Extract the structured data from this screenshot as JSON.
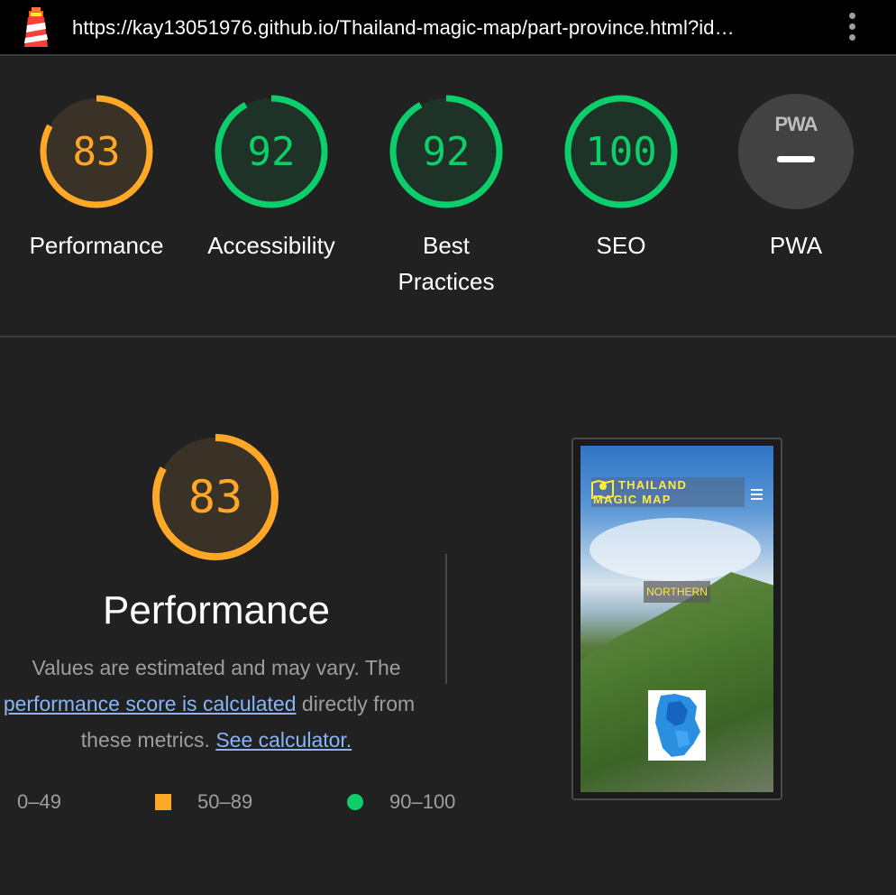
{
  "browser": {
    "url": "https://kay13051976.github.io/Thailand-magic-map/part-province.html?id…"
  },
  "categories": [
    {
      "label": "Performance",
      "score": "83",
      "value": 0.83,
      "status": "average"
    },
    {
      "label": "Accessibility",
      "score": "92",
      "value": 0.92,
      "status": "pass"
    },
    {
      "label": "Best Practices",
      "score": "92",
      "value": 0.92,
      "status": "pass"
    },
    {
      "label": "SEO",
      "score": "100",
      "value": 1.0,
      "status": "pass"
    },
    {
      "label": "PWA",
      "score": "",
      "status": "not-applicable"
    }
  ],
  "pwa_badge": "PWA",
  "performance": {
    "score": "83",
    "value": 0.83,
    "title": "Performance",
    "desc_line1": "Values are estimated and may vary. The",
    "desc_link": "performance score is calculated",
    "desc_line2_rest": " directly from",
    "desc_line3": "these metrics. ",
    "calculator_link": "See calculator."
  },
  "legend": [
    {
      "range": "0–49",
      "color": "#ff4e42",
      "shape": "triangle"
    },
    {
      "range": "50–89",
      "color": "#ffa726",
      "shape": "square"
    },
    {
      "range": "90–100",
      "color": "#0cce6b",
      "shape": "circle"
    }
  ],
  "screenshot": {
    "brand_line1": "THAILAND",
    "brand_line2": "MAGIC MAP",
    "region": "NORTHERN"
  },
  "colors": {
    "average": "#ffa726",
    "pass": "#0cce6b",
    "fail": "#ff4e42",
    "link": "#8ab4f8",
    "background": "#212121"
  },
  "icons": [
    "lighthouse-icon",
    "more-vert-icon",
    "pwa-dash-icon",
    "map-pin-icon",
    "hamburger-icon"
  ]
}
